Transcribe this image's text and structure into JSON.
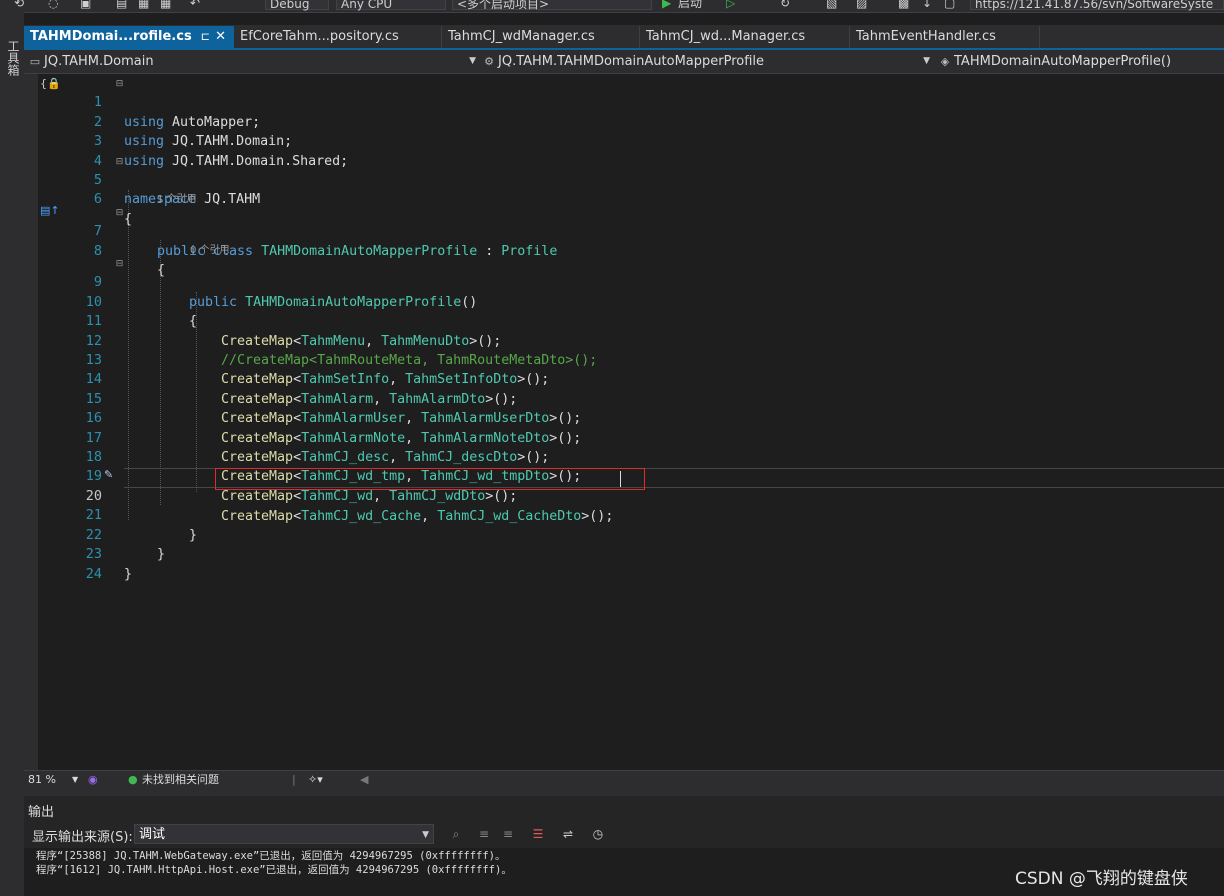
{
  "toolbar": {
    "config": "Debug",
    "platform": "Any CPU",
    "startup": "<多个启动项目>",
    "start_label": "启动",
    "url": "https://121.41.87.56/svn/SoftwareSyste"
  },
  "left_strip": {
    "label": "工具箱"
  },
  "tabs": [
    {
      "label": "TAHMDomai...rofile.cs",
      "active": true
    },
    {
      "label": "EfCoreTahm...pository.cs"
    },
    {
      "label": "TahmCJ_wdManager.cs"
    },
    {
      "label": "TahmCJ_wd...Manager.cs"
    },
    {
      "label": "TahmEventHandler.cs"
    }
  ],
  "navbar": {
    "project": "JQ.TAHM.Domain",
    "class": "JQ.TAHM.TAHMDomainAutoMapperProfile",
    "member": "TAHMDomainAutoMapperProfile()"
  },
  "code": {
    "lens_class": "1 个引用",
    "lens_ctor": "0 个引用",
    "lines": {
      "l1": {
        "n": "1",
        "kw": "using",
        "rest": " AutoMapper;"
      },
      "l2": {
        "n": "2",
        "kw": "using",
        "rest": " JQ.TAHM.Domain;"
      },
      "l3": {
        "n": "3",
        "kw": "using",
        "rest": " JQ.TAHM.Domain.Shared;"
      },
      "l4": {
        "n": "4"
      },
      "l5": {
        "n": "5",
        "kw": "namespace",
        "rest": " JQ.TAHM"
      },
      "l6": {
        "n": "6",
        "text": "{"
      },
      "l7": {
        "n": "7",
        "kw": "public class",
        "name": "TAHMDomainAutoMapperProfile",
        "sep": " : ",
        "base": "Profile"
      },
      "l8": {
        "n": "8",
        "text": "{"
      },
      "l9": {
        "n": "9",
        "kw": "public",
        "name": "TAHMDomainAutoMapperProfile",
        "tail": "()"
      },
      "l10": {
        "n": "10",
        "text": "{"
      },
      "l11": {
        "n": "11",
        "m": "CreateMap",
        "a": "TahmMenu",
        "b": "TahmMenuDto"
      },
      "l12": {
        "n": "12",
        "comment": "//CreateMap<TahmRouteMeta, TahmRouteMetaDto>();"
      },
      "l13": {
        "n": "13",
        "m": "CreateMap",
        "a": "TahmSetInfo",
        "b": "TahmSetInfoDto"
      },
      "l14": {
        "n": "14",
        "m": "CreateMap",
        "a": "TahmAlarm",
        "b": "TahmAlarmDto"
      },
      "l15": {
        "n": "15",
        "m": "CreateMap",
        "a": "TahmAlarmUser",
        "b": "TahmAlarmUserDto"
      },
      "l16": {
        "n": "16",
        "m": "CreateMap",
        "a": "TahmAlarmNote",
        "b": "TahmAlarmNoteDto"
      },
      "l17": {
        "n": "17",
        "m": "CreateMap",
        "a": "TahmCJ_desc",
        "b": "TahmCJ_descDto"
      },
      "l18": {
        "n": "18",
        "m": "CreateMap",
        "a": "TahmCJ_wd_tmp",
        "b": "TahmCJ_wd_tmpDto"
      },
      "l19": {
        "n": "19",
        "m": "CreateMap",
        "a": "TahmCJ_wd",
        "b": "TahmCJ_wdDto"
      },
      "l20": {
        "n": "20",
        "m": "CreateMap",
        "a": "TahmCJ_wd_Cache",
        "b": "TahmCJ_wd_CacheDto"
      },
      "l21": {
        "n": "21",
        "text": "}"
      },
      "l22": {
        "n": "22",
        "text": "}"
      },
      "l23": {
        "n": "23",
        "text": "}"
      },
      "l24": {
        "n": "24"
      }
    }
  },
  "status": {
    "zoom": "81 %",
    "issues": "未找到相关问题"
  },
  "output": {
    "title": "输出",
    "source_label": "显示输出来源(S):",
    "source_value": "调试",
    "lines": [
      "程序“[25388] JQ.TAHM.WebGateway.exe”已退出，返回值为 4294967295 (0xffffffff)。",
      "程序“[1612] JQ.TAHM.HttpApi.Host.exe”已退出，返回值为 4294967295 (0xffffffff)。"
    ]
  },
  "watermark": "CSDN @飞翔的键盘侠",
  "colors": {
    "keyword": "#569cd6",
    "type": "#4ec9b0",
    "method": "#dcdcaa",
    "comment": "#57a64a",
    "highlight_box": "#e02b2b",
    "active_tab": "#0e639c"
  }
}
